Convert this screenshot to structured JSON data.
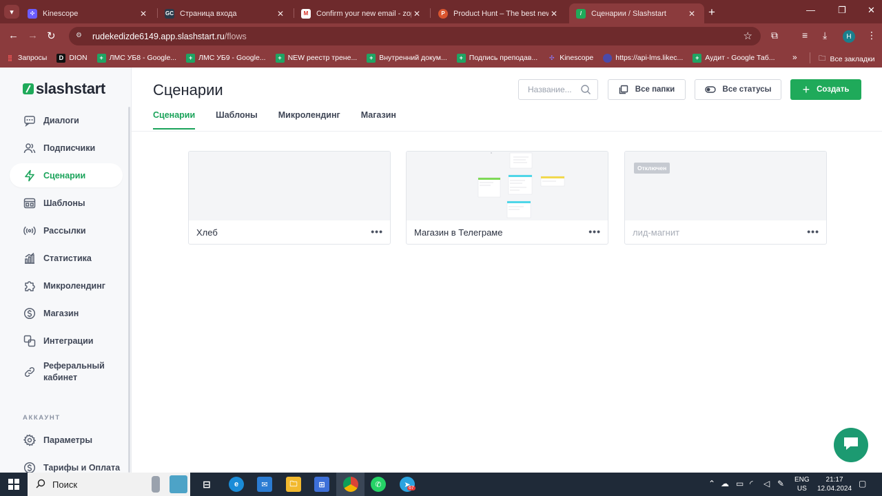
{
  "browser": {
    "tabs": [
      {
        "title": "Kinescope",
        "favicon": "kinescope-icon",
        "color": "#6b5cff"
      },
      {
        "title": "Страница входа",
        "favicon": "gc-icon",
        "color": "#2a3a4a"
      },
      {
        "title": "Confirm your new email - zopu",
        "favicon": "gmail-icon",
        "color": "#ffffff"
      },
      {
        "title": "Product Hunt – The best new p",
        "favicon": "product-hunt-icon",
        "color": "#da552f"
      },
      {
        "title": "Сценарии / Slashstart",
        "favicon": "slashstart-icon",
        "color": "#1faa5a"
      }
    ],
    "url_host": "rudekedizde6149.app.slashstart.ru",
    "url_path": "/flows",
    "profile_initial": "H",
    "bookmarks": [
      {
        "label": "Запросы",
        "icon": "apps-icon",
        "color": "#e44"
      },
      {
        "label": "DION",
        "icon": "dion-icon",
        "color": "#111"
      },
      {
        "label": "ЛМС УБ8 - Google...",
        "icon": "sheets-icon",
        "color": "#1fa463"
      },
      {
        "label": "ЛМС УБ9 - Google...",
        "icon": "sheets-icon",
        "color": "#1fa463"
      },
      {
        "label": "NEW реестр трене...",
        "icon": "sheets-icon",
        "color": "#1fa463"
      },
      {
        "label": "Внутренний докум...",
        "icon": "sheets-icon",
        "color": "#1fa463"
      },
      {
        "label": "Подпись преподав...",
        "icon": "sheets-icon",
        "color": "#1fa463"
      },
      {
        "label": "Kinescope",
        "icon": "kinescope-icon",
        "color": "#6b5cff"
      },
      {
        "label": "https://api-lms.likec...",
        "icon": "globe-icon",
        "color": "#4a4aaa"
      },
      {
        "label": "Аудит - Google Таб...",
        "icon": "sheets-icon",
        "color": "#1fa463"
      }
    ],
    "all_bookmarks": "Все закладки"
  },
  "sidebar": {
    "logo": "slashstart",
    "items": [
      {
        "label": "Диалоги",
        "icon": "chat-icon"
      },
      {
        "label": "Подписчики",
        "icon": "users-icon"
      },
      {
        "label": "Сценарии",
        "icon": "lightning-icon"
      },
      {
        "label": "Шаблоны",
        "icon": "template-icon"
      },
      {
        "label": "Рассылки",
        "icon": "broadcast-icon"
      },
      {
        "label": "Статистика",
        "icon": "stats-icon"
      },
      {
        "label": "Микролендинг",
        "icon": "puzzle-icon"
      },
      {
        "label": "Магазин",
        "icon": "dollar-icon"
      },
      {
        "label": "Интеграции",
        "icon": "integrations-icon"
      },
      {
        "label": "Реферальный кабинет",
        "line1": "Реферальный",
        "line2": "кабинет",
        "icon": "link-icon"
      }
    ],
    "account_label": "АККАУНТ",
    "account_items": [
      {
        "label": "Параметры",
        "icon": "gear-icon"
      },
      {
        "label": "Тарифы и Оплата",
        "icon": "dollar-icon"
      }
    ]
  },
  "main": {
    "title": "Сценарии",
    "search_placeholder": "Название...",
    "folders_button": "Все папки",
    "status_button": "Все статусы",
    "create_button": "Создать",
    "tabs": [
      "Сценарии",
      "Шаблоны",
      "Микролендинг",
      "Магазин"
    ],
    "cards": [
      {
        "name": "Хлеб",
        "status": ""
      },
      {
        "name": "Магазин в Телеграме",
        "status": ""
      },
      {
        "name": "лид-магнит",
        "status": "Отключен"
      }
    ],
    "more_label": "•••"
  },
  "taskbar": {
    "search_label": "Поиск",
    "lang_line1": "ENG",
    "lang_line2": "US",
    "time": "21:17",
    "date": "12.04.2024",
    "telegram_badge": "67"
  },
  "colors": {
    "accent": "#1aa35a",
    "browser_frame": "#8b3b3d",
    "taskbar": "#1f2a38"
  }
}
